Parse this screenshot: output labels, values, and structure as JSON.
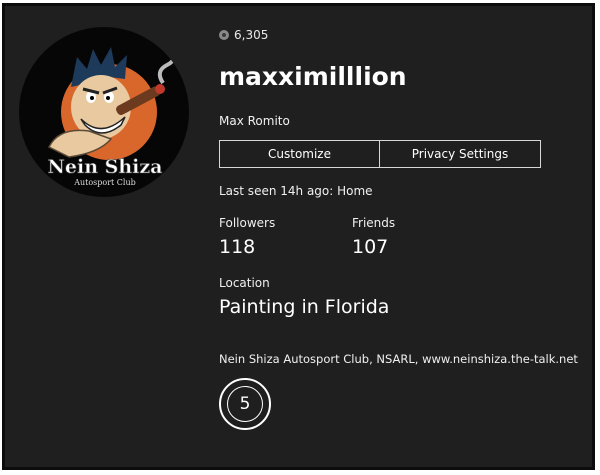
{
  "profile": {
    "gamerscore": "6,305",
    "gamertag": "maxximilllion",
    "real_name": "Max Romito",
    "last_seen": "Last seen 14h ago: Home",
    "bio": "Nein Shiza Autosport Club, NSARL, www.neinshiza.the-talk.net",
    "reputation_level": "5"
  },
  "buttons": {
    "customize": "Customize",
    "privacy": "Privacy Settings"
  },
  "stats": {
    "followers_label": "Followers",
    "followers_value": "118",
    "friends_label": "Friends",
    "friends_value": "107"
  },
  "location": {
    "label": "Location",
    "value": "Painting in Florida"
  },
  "avatar": {
    "logo_line1": "Nein Shiza",
    "logo_line2": "Autosport Club"
  },
  "icons": {
    "gamerscore": "gamerscore-icon",
    "reputation": "reputation-badge"
  },
  "colors": {
    "background": "#1f1f1f",
    "text": "#ffffff",
    "border": "#d8d8d8"
  }
}
